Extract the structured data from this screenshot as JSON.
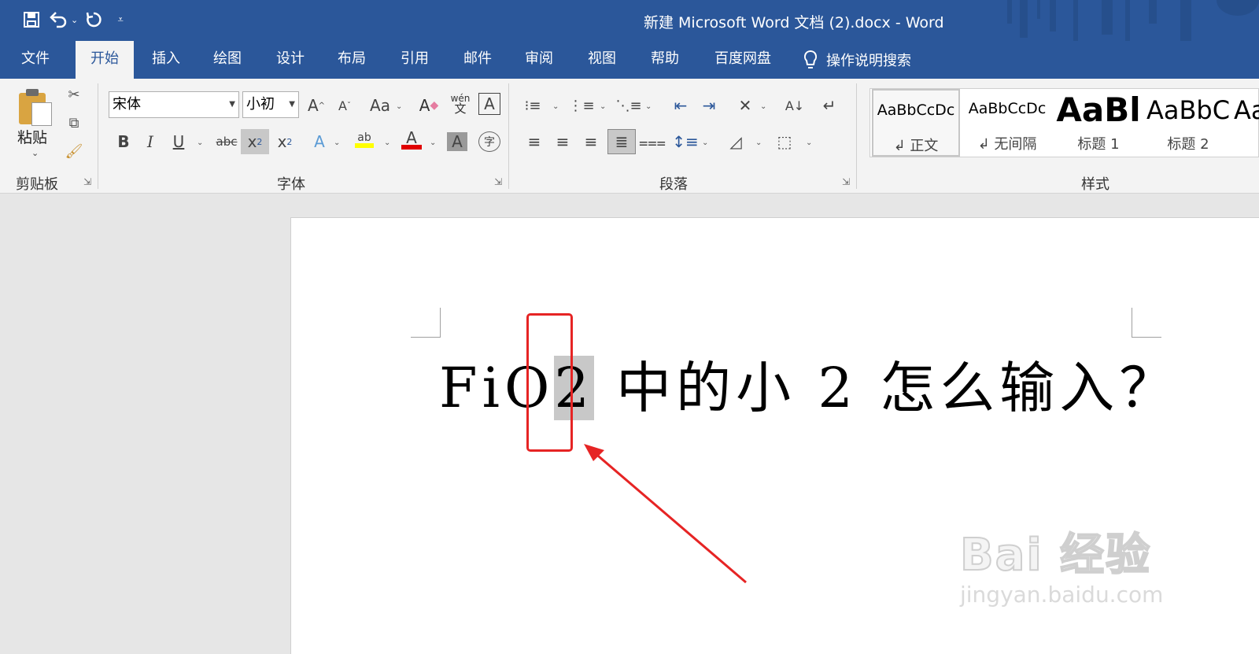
{
  "window": {
    "title": "新建 Microsoft Word 文档 (2).docx  -  Word"
  },
  "qat": [
    {
      "name": "save-icon",
      "glyph": "🖫"
    },
    {
      "name": "undo-icon",
      "glyph": "↶"
    },
    {
      "name": "redo-icon",
      "glyph": "↻"
    },
    {
      "name": "customize-icon",
      "glyph": "⌄"
    }
  ],
  "tabs": [
    "文件",
    "开始",
    "插入",
    "绘图",
    "设计",
    "布局",
    "引用",
    "邮件",
    "审阅",
    "视图",
    "帮助",
    "百度网盘"
  ],
  "active_tab": "开始",
  "tell_me": "操作说明搜索",
  "clipboard": {
    "paste": "粘贴",
    "group": "剪贴板"
  },
  "font": {
    "name": "宋体",
    "size": "小初",
    "group": "字体"
  },
  "paragraph": {
    "group": "段落"
  },
  "styles": {
    "group": "样式",
    "items": [
      {
        "sample": "AaBbCcDc",
        "name": "↲ 正文"
      },
      {
        "sample": "AaBbCcDc",
        "name": "↲ 无间隔"
      },
      {
        "sample": "AaBl",
        "name": "标题 1"
      },
      {
        "sample": "AaBbC",
        "name": "标题 2"
      },
      {
        "sample": "Aa",
        "name": ""
      }
    ]
  },
  "document": {
    "text_before": "FiO",
    "text_selected": "2",
    "text_after": " 中的小 2 怎么输入？"
  },
  "watermark": {
    "brand": "Bai 经验",
    "url": "jingyan.baidu.com"
  },
  "colors": {
    "accent": "#2b579a",
    "highlight": "#ffff00",
    "font_color": "#e00000",
    "annotation": "#e62424"
  }
}
